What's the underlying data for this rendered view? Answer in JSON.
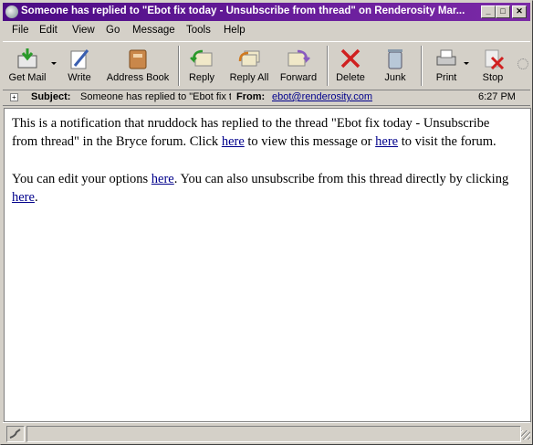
{
  "window": {
    "title": "Someone has replied to \"Ebot fix today - Unsubscribe from thread\" on Renderosity Mar..."
  },
  "menu": [
    "File",
    "Edit",
    "View",
    "Go",
    "Message",
    "Tools",
    "Help"
  ],
  "toolbar": {
    "get_mail": "Get Mail",
    "write": "Write",
    "address_book": "Address Book",
    "reply": "Reply",
    "reply_all": "Reply All",
    "forward": "Forward",
    "delete": "Delete",
    "junk": "Junk",
    "print": "Print",
    "stop": "Stop"
  },
  "header": {
    "subject_label": "Subject:",
    "subject_value": "Someone has replied to \"Ebot fix t",
    "from_label": "From:",
    "from_value": "ebot@renderosity.com",
    "time": "6:27 PM"
  },
  "body": {
    "p1_a": "This is a notification that nruddock has replied to the thread \"Ebot fix today - Unsubscribe from thread\" in the Bryce forum. Click ",
    "p1_link1": "here",
    "p1_b": " to view this message or ",
    "p1_link2": "here",
    "p1_c": " to visit the forum.",
    "p2_a": "You can edit your options ",
    "p2_link1": "here",
    "p2_b": ". You can also unsubscribe from this thread directly by clicking ",
    "p2_link2": "here",
    "p2_c": "."
  },
  "colors": {
    "titlebar": "#4b0b84",
    "link": "#00008b",
    "chrome": "#d4d0c8"
  }
}
